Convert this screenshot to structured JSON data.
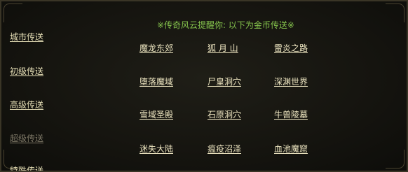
{
  "notice": "※传奇风云提醒你: 以下为金币传送※",
  "sidebar": {
    "items": [
      {
        "label": "城市传送",
        "enabled": true
      },
      {
        "label": "初级传送",
        "enabled": true
      },
      {
        "label": "高级传送",
        "enabled": true
      },
      {
        "label": "超级传送",
        "enabled": false
      },
      {
        "label": "特殊传送",
        "enabled": true
      }
    ]
  },
  "destinations": {
    "rows": [
      [
        "魔龙东郊",
        "狐 月 山",
        "雷炎之路"
      ],
      [
        "堕落魔域",
        "尸皇洞穴",
        "深渊世界"
      ],
      [
        "雪域圣殿",
        "石原洞穴",
        "牛兽陵墓"
      ],
      [
        "迷失大陆",
        "瘟疫沼泽",
        "血池魔窟"
      ]
    ]
  },
  "colors": {
    "notice": "#84c24c",
    "link": "#ede5c0",
    "disabled": "#7c7665",
    "background": "#141410"
  }
}
